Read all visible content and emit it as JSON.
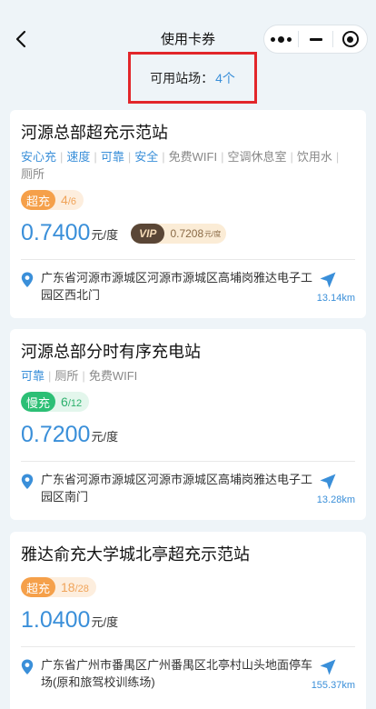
{
  "nav": {
    "title": "使用卡券"
  },
  "available": {
    "label": "可用站场：",
    "count": "4个"
  },
  "stations": [
    {
      "name": "河源总部超充示范站",
      "tags": [
        {
          "text": "安心充",
          "color": "blue"
        },
        {
          "text": "速度",
          "color": "blue"
        },
        {
          "text": "可靠",
          "color": "blue"
        },
        {
          "text": "安全",
          "color": "blue"
        },
        {
          "text": "免费WIFI",
          "color": "gray"
        },
        {
          "text": "空调休息室",
          "color": "gray"
        },
        {
          "text": "饮用水",
          "color": "gray"
        },
        {
          "text": "厕所",
          "color": "gray"
        }
      ],
      "charge_type": "超充",
      "available": "4",
      "total": "/6",
      "price": "0.7400",
      "unit": "元/度",
      "vip_label": "VIP",
      "vip_price": "0.7208",
      "vip_unit": "元/度",
      "address": "广东省河源市源城区河源市源城区高埔岗雅达电子工园区西北门",
      "distance": "13.14km"
    },
    {
      "name": "河源总部分时有序充电站",
      "tags": [
        {
          "text": "可靠",
          "color": "blue"
        },
        {
          "text": "厕所",
          "color": "gray"
        },
        {
          "text": "免费WIFI",
          "color": "gray"
        }
      ],
      "charge_type": "慢充",
      "available": "6",
      "total": "/12",
      "price": "0.7200",
      "unit": "元/度",
      "address": "广东省河源市源城区河源市源城区高埔岗雅达电子工园区南门",
      "distance": "13.28km"
    },
    {
      "name": "雅达俞充大学城北亭超充示范站",
      "tags": [],
      "charge_type": "超充",
      "available": "18",
      "total": "/28",
      "price": "1.0400",
      "unit": "元/度",
      "address": "广东省广州市番禺区广州番禺区北亭村山头地面停车场(原和旅驾校训练场)",
      "distance": "155.37km"
    }
  ],
  "colors": {
    "accent": "#3a8fd9",
    "super_charge": "#f5a04a",
    "slow_charge": "#2cbf75",
    "highlight_border": "#e2262a"
  }
}
